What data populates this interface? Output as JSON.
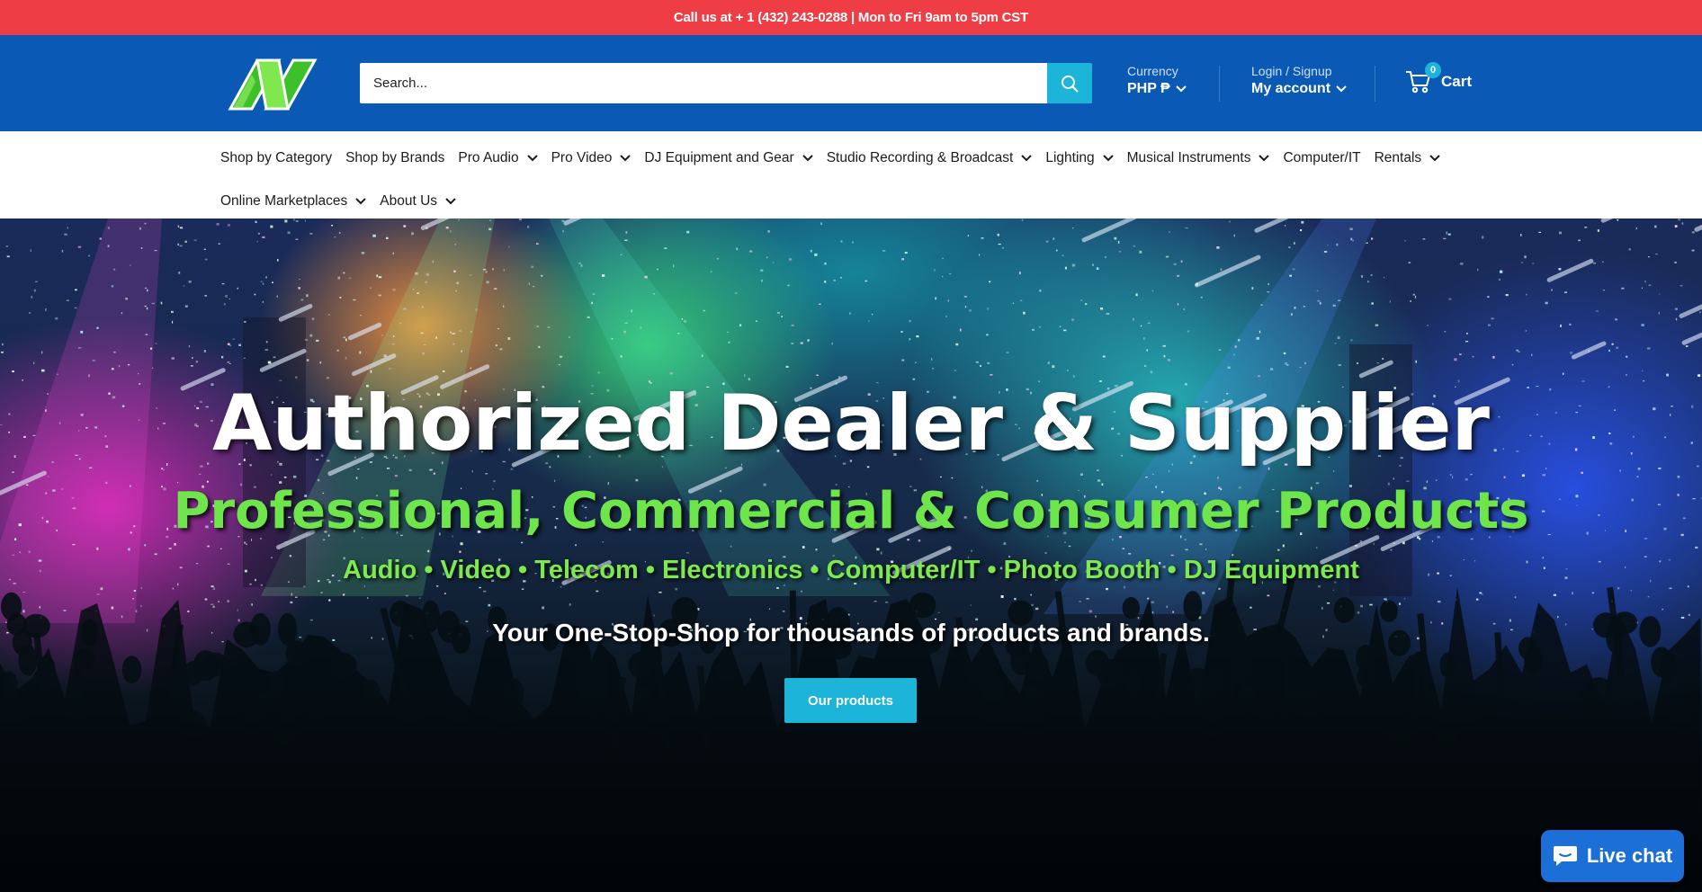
{
  "announcement": {
    "text": "Call us at + 1 (432) 243-0288 | Mon to Fri 9am to 5pm CST"
  },
  "header": {
    "logo_name": "brand-logo",
    "search": {
      "placeholder": "Search..."
    },
    "currency": {
      "label": "Currency",
      "value": "PHP ₱"
    },
    "account": {
      "label": "Login / Signup",
      "value": "My account"
    },
    "cart": {
      "label": "Cart",
      "count": "0"
    }
  },
  "nav": {
    "row1": [
      {
        "label": "Shop by Category",
        "dropdown": false
      },
      {
        "label": "Shop by Brands",
        "dropdown": false
      },
      {
        "label": "Pro Audio",
        "dropdown": true
      },
      {
        "label": "Pro Video",
        "dropdown": true
      },
      {
        "label": "DJ Equipment and Gear",
        "dropdown": true
      },
      {
        "label": "Studio Recording & Broadcast",
        "dropdown": true
      },
      {
        "label": "Lighting",
        "dropdown": true
      },
      {
        "label": "Musical Instruments",
        "dropdown": true
      },
      {
        "label": "Computer/IT",
        "dropdown": false
      },
      {
        "label": "Rentals",
        "dropdown": true
      }
    ],
    "row2": [
      {
        "label": "Online Marketplaces",
        "dropdown": true
      },
      {
        "label": "About Us",
        "dropdown": true
      }
    ]
  },
  "hero": {
    "title": "Authorized Dealer & Supplier",
    "subtitle": "Professional, Commercial & Consumer Products",
    "categories": "Audio • Video • Telecom • Electronics • Computer/IT • Photo Booth • DJ Equipment",
    "tagline": "Your One-Stop-Shop for thousands of products and brands.",
    "cta": "Our products"
  },
  "livechat": {
    "label": "Live chat"
  },
  "colors": {
    "announce_bg": "#ee3d45",
    "header_bg": "#0a5ab5",
    "accent": "#1cb5d9",
    "hero_green": "#6ee54a",
    "chat_bg": "#1b6fd6"
  }
}
